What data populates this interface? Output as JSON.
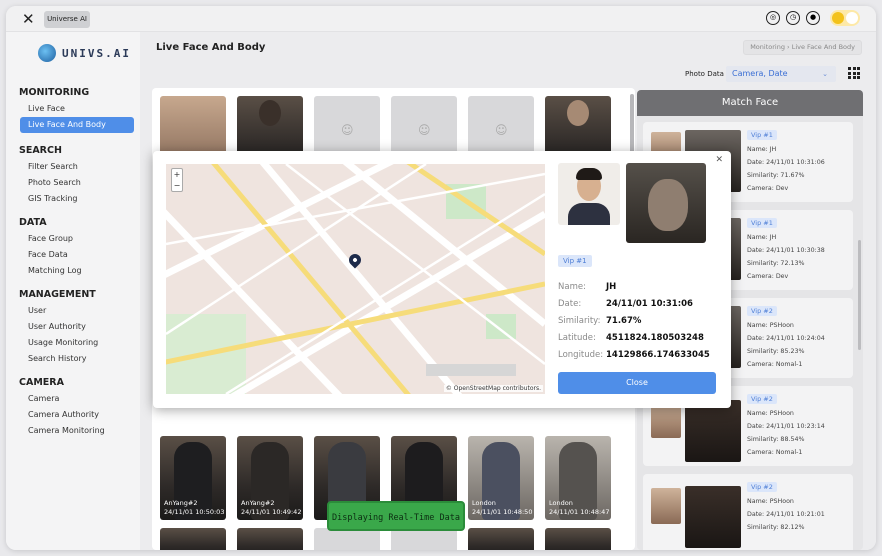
{
  "app": {
    "tab_label": "Universe AI",
    "brand": "UNIVS.AI"
  },
  "nav": {
    "sections": [
      {
        "title": "MONITORING",
        "items": [
          "Live Face",
          "Live Face And Body"
        ]
      },
      {
        "title": "SEARCH",
        "items": [
          "Filter Search",
          "Photo Search",
          "GIS Tracking"
        ]
      },
      {
        "title": "DATA",
        "items": [
          "Face Group",
          "Face Data",
          "Matching Log"
        ]
      },
      {
        "title": "MANAGEMENT",
        "items": [
          "User",
          "User Authority",
          "Usage Monitoring",
          "Search History"
        ]
      },
      {
        "title": "CAMERA",
        "items": [
          "Camera",
          "Camera Authority",
          "Camera Monitoring"
        ]
      }
    ],
    "active_item": "Live Face And Body"
  },
  "header": {
    "title": "Live Face And Body",
    "breadcrumb": [
      "Monitoring",
      "Live Face And Body"
    ],
    "photo_data_label": "Photo Data",
    "photo_data_value": "Camera, Date"
  },
  "gallery": {
    "bottom_captions": [
      {
        "camera": "AnYang#2",
        "time": "24/11/01 10:50:03"
      },
      {
        "camera": "AnYang#2",
        "time": "24/11/01 10:49:42"
      },
      {
        "camera": "",
        "time": ""
      },
      {
        "camera": "",
        "time": ""
      },
      {
        "camera": "London",
        "time": "24/11/01 10:48:50"
      },
      {
        "camera": "London",
        "time": "24/11/01 10:48:47"
      }
    ],
    "realtime_label": "Displaying Real-Time Data"
  },
  "match_panel": {
    "title": "Match Face",
    "cards": [
      {
        "vip": "Vip #1",
        "name": "Name: JH",
        "date": "Date: 24/11/01 10:31:06",
        "similarity": "Similarity: 71.67%",
        "camera": "Camera: Dev"
      },
      {
        "vip": "Vip #1",
        "name": "Name: JH",
        "date": "Date: 24/11/01 10:30:38",
        "similarity": "Similarity: 72.13%",
        "camera": "Camera: Dev"
      },
      {
        "vip": "Vip #2",
        "name": "Name: PSHoon",
        "date": "Date: 24/11/01 10:24:04",
        "similarity": "Similarity: 85.23%",
        "camera": "Camera: Nomal-1"
      },
      {
        "vip": "Vip #2",
        "name": "Name: PSHoon",
        "date": "Date: 24/11/01 10:23:14",
        "similarity": "Similarity: 88.54%",
        "camera": "Camera: Nomal-1"
      },
      {
        "vip": "Vip #2",
        "name": "Name: PSHoon",
        "date": "Date: 24/11/01 10:21:01",
        "similarity": "Similarity: 82.12%",
        "camera": ""
      }
    ]
  },
  "modal": {
    "vip": "Vip #1",
    "fields": [
      {
        "label": "Name:",
        "value": "JH"
      },
      {
        "label": "Date:",
        "value": "24/11/01 10:31:06"
      },
      {
        "label": "Similarity:",
        "value": "71.67%"
      },
      {
        "label": "Latitude:",
        "value": "4511824.180503248"
      },
      {
        "label": "Longitude:",
        "value": "14129866.174633045"
      }
    ],
    "close_label": "Close",
    "map_attribution": "© OpenStreetMap contributors.",
    "zoom_in": "+",
    "zoom_out": "−"
  },
  "colors": {
    "accent": "#4f8ee8",
    "realtime_green": "#3aa84a",
    "match_header": "#6f6f72"
  }
}
